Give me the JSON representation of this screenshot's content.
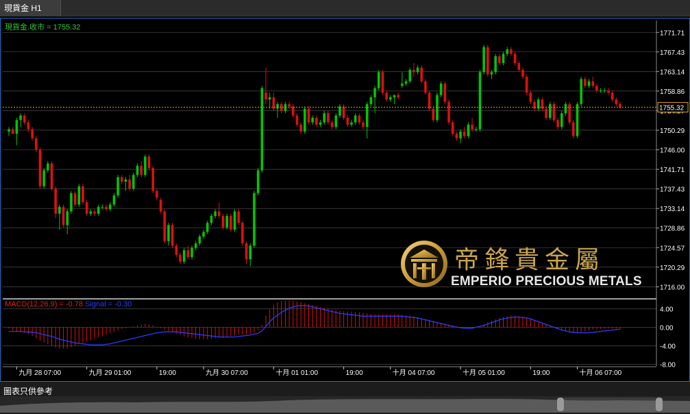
{
  "tab": {
    "label": "現貨金 H1"
  },
  "price_legend": {
    "text": "現貨金.收市 = 1755.32"
  },
  "macd_legend": {
    "macd_text": "MACD(12,26,9) = -0.78",
    "signal_text": "Signal = -0.30"
  },
  "logo": {
    "cn": "帝鋒貴金屬",
    "en": "EMPERIO PRECIOUS METALS"
  },
  "footer": {
    "text": "圖表只供參考"
  },
  "colors": {
    "up": "#00c800",
    "down": "#e01010",
    "grid": "#5a5a5a",
    "macd_hist": "#e01010",
    "signal": "#2a3cff",
    "price_line": "#e8a000",
    "axis_text": "#ffffff"
  },
  "chart_data": {
    "type": "candlestick",
    "price_axis": {
      "ylim": [
        1713.5,
        1774.3
      ],
      "ticks": [
        1771.71,
        1767.43,
        1763.14,
        1758.86,
        1754.57,
        1750.29,
        1746.0,
        1741.71,
        1737.43,
        1733.14,
        1728.86,
        1724.57,
        1720.29,
        1716.0
      ],
      "current_price": 1755.32,
      "current_label": "1755.32"
    },
    "macd_axis": {
      "ylim": [
        -8.4,
        6.0
      ],
      "ticks": [
        "4.00",
        "0.00",
        "-4.00",
        "-8.00"
      ],
      "ticks_values": [
        4,
        0,
        -4,
        -8
      ]
    },
    "x_labels": [
      {
        "label": "九月 28 07:00",
        "bar": 2
      },
      {
        "label": "九月 29 01:00",
        "bar": 20
      },
      {
        "label": "19:00",
        "bar": 38
      },
      {
        "label": "九月 30 07:00",
        "bar": 50
      },
      {
        "label": "十月 01 01:00",
        "bar": 68
      },
      {
        "label": "19:00",
        "bar": 86
      },
      {
        "label": "十月 04 07:00",
        "bar": 98
      },
      {
        "label": "十月 05 01:00",
        "bar": 116
      },
      {
        "label": "19:00",
        "bar": 134
      },
      {
        "label": "十月 06 07:00",
        "bar": 146
      }
    ],
    "candles": [
      [
        1750.0,
        1751.0,
        1749.0,
        1750.5
      ],
      [
        1750.5,
        1751.0,
        1749.5,
        1749.5
      ],
      [
        1749.5,
        1753.0,
        1747.0,
        1752.5
      ],
      [
        1752.5,
        1754.0,
        1751.0,
        1753.5
      ],
      [
        1753.5,
        1754.0,
        1751.5,
        1752.0
      ],
      [
        1752.0,
        1752.5,
        1750.0,
        1750.5
      ],
      [
        1750.5,
        1751.0,
        1748.0,
        1748.5
      ],
      [
        1748.5,
        1749.0,
        1745.5,
        1746.0
      ],
      [
        1746.0,
        1746.5,
        1737.5,
        1738.0
      ],
      [
        1738.0,
        1742.0,
        1737.5,
        1741.5
      ],
      [
        1741.5,
        1743.5,
        1741.0,
        1743.0
      ],
      [
        1743.0,
        1743.5,
        1737.0,
        1737.5
      ],
      [
        1737.5,
        1738.0,
        1731.0,
        1732.0
      ],
      [
        1732.0,
        1734.0,
        1728.5,
        1733.5
      ],
      [
        1733.5,
        1734.0,
        1729.0,
        1729.5
      ],
      [
        1729.5,
        1733.0,
        1727.5,
        1732.5
      ],
      [
        1732.5,
        1737.0,
        1732.0,
        1736.5
      ],
      [
        1736.5,
        1737.0,
        1733.5,
        1734.0
      ],
      [
        1734.0,
        1738.5,
        1733.5,
        1738.0
      ],
      [
        1738.0,
        1738.5,
        1734.0,
        1734.5
      ],
      [
        1734.5,
        1735.0,
        1731.5,
        1732.0
      ],
      [
        1732.0,
        1733.0,
        1731.5,
        1732.5
      ],
      [
        1732.5,
        1733.0,
        1731.5,
        1732.0
      ],
      [
        1732.0,
        1734.0,
        1731.5,
        1733.5
      ],
      [
        1733.5,
        1734.0,
        1733.0,
        1733.5
      ],
      [
        1733.5,
        1734.0,
        1732.5,
        1733.0
      ],
      [
        1733.0,
        1734.5,
        1732.5,
        1734.0
      ],
      [
        1734.0,
        1736.5,
        1733.5,
        1736.0
      ],
      [
        1736.0,
        1740.5,
        1735.5,
        1740.0
      ],
      [
        1740.0,
        1740.5,
        1738.5,
        1739.0
      ],
      [
        1739.0,
        1740.0,
        1737.0,
        1739.5
      ],
      [
        1739.5,
        1740.5,
        1737.0,
        1737.5
      ],
      [
        1737.5,
        1741.0,
        1737.0,
        1740.5
      ],
      [
        1740.5,
        1743.0,
        1740.0,
        1742.5
      ],
      [
        1742.5,
        1743.5,
        1740.0,
        1740.5
      ],
      [
        1740.5,
        1745.0,
        1740.0,
        1744.5
      ],
      [
        1744.5,
        1745.0,
        1741.5,
        1742.0
      ],
      [
        1742.0,
        1742.5,
        1736.5,
        1737.0
      ],
      [
        1737.0,
        1737.5,
        1735.0,
        1735.5
      ],
      [
        1735.0,
        1735.5,
        1732.0,
        1732.5
      ],
      [
        1732.5,
        1733.0,
        1725.5,
        1726.0
      ],
      [
        1726.0,
        1730.0,
        1725.0,
        1729.5
      ],
      [
        1729.5,
        1730.0,
        1724.5,
        1725.0
      ],
      [
        1725.0,
        1725.5,
        1722.5,
        1723.0
      ],
      [
        1723.0,
        1723.5,
        1721.0,
        1721.5
      ],
      [
        1721.5,
        1724.5,
        1721.0,
        1724.0
      ],
      [
        1724.0,
        1725.0,
        1722.0,
        1722.5
      ],
      [
        1722.5,
        1725.0,
        1722.0,
        1724.5
      ],
      [
        1724.5,
        1726.0,
        1724.0,
        1725.5
      ],
      [
        1725.5,
        1727.5,
        1725.0,
        1727.0
      ],
      [
        1727.0,
        1728.5,
        1726.5,
        1728.0
      ],
      [
        1728.0,
        1730.5,
        1727.5,
        1730.0
      ],
      [
        1730.0,
        1732.0,
        1729.5,
        1731.5
      ],
      [
        1731.5,
        1733.0,
        1731.0,
        1732.5
      ],
      [
        1732.5,
        1734.5,
        1731.0,
        1731.5
      ],
      [
        1731.5,
        1732.0,
        1728.5,
        1729.0
      ],
      [
        1729.0,
        1732.0,
        1728.5,
        1731.5
      ],
      [
        1731.5,
        1732.0,
        1728.0,
        1728.5
      ],
      [
        1728.5,
        1733.0,
        1728.0,
        1732.5
      ],
      [
        1732.5,
        1733.0,
        1729.5,
        1730.0
      ],
      [
        1730.0,
        1730.5,
        1725.0,
        1725.5
      ],
      [
        1725.5,
        1726.0,
        1721.0,
        1722.0
      ],
      [
        1722.0,
        1725.5,
        1720.5,
        1725.0
      ],
      [
        1725.0,
        1737.0,
        1724.5,
        1736.5
      ],
      [
        1736.5,
        1742.0,
        1736.0,
        1741.5
      ],
      [
        1741.5,
        1760.0,
        1741.0,
        1759.5
      ],
      [
        1758.5,
        1764.0,
        1756.0,
        1757.0
      ],
      [
        1757.0,
        1758.5,
        1755.0,
        1757.5
      ],
      [
        1757.5,
        1758.5,
        1754.5,
        1755.0
      ],
      [
        1755.0,
        1756.5,
        1753.0,
        1756.0
      ],
      [
        1756.0,
        1756.5,
        1754.0,
        1754.5
      ],
      [
        1754.5,
        1756.5,
        1754.0,
        1756.0
      ],
      [
        1756.0,
        1756.5,
        1755.0,
        1755.5
      ],
      [
        1755.5,
        1756.0,
        1753.0,
        1753.5
      ],
      [
        1753.5,
        1754.0,
        1751.0,
        1751.5
      ],
      [
        1751.5,
        1752.0,
        1749.5,
        1750.0
      ],
      [
        1750.0,
        1755.5,
        1749.5,
        1755.0
      ],
      [
        1755.0,
        1755.5,
        1751.5,
        1752.0
      ],
      [
        1752.0,
        1753.5,
        1751.5,
        1753.0
      ],
      [
        1753.0,
        1753.5,
        1751.0,
        1751.5
      ],
      [
        1751.5,
        1752.5,
        1751.0,
        1752.0
      ],
      [
        1752.0,
        1754.5,
        1751.5,
        1754.0
      ],
      [
        1754.0,
        1754.5,
        1751.5,
        1752.0
      ],
      [
        1752.0,
        1752.5,
        1750.5,
        1751.0
      ],
      [
        1751.0,
        1754.0,
        1750.5,
        1753.5
      ],
      [
        1753.5,
        1756.0,
        1753.0,
        1755.5
      ],
      [
        1755.5,
        1756.0,
        1752.5,
        1753.0
      ],
      [
        1753.0,
        1753.5,
        1751.0,
        1751.5
      ],
      [
        1751.5,
        1752.5,
        1751.0,
        1752.0
      ],
      [
        1752.0,
        1754.0,
        1751.5,
        1753.5
      ],
      [
        1753.5,
        1754.0,
        1751.5,
        1752.0
      ],
      [
        1752.0,
        1752.5,
        1750.5,
        1751.0
      ],
      [
        1751.0,
        1756.5,
        1748.5,
        1756.0
      ],
      [
        1756.0,
        1758.0,
        1755.5,
        1757.5
      ],
      [
        1757.5,
        1760.0,
        1754.0,
        1759.5
      ],
      [
        1759.5,
        1763.5,
        1759.0,
        1763.0
      ],
      [
        1763.0,
        1763.5,
        1758.0,
        1758.5
      ],
      [
        1758.5,
        1759.0,
        1756.5,
        1757.0
      ],
      [
        1757.0,
        1758.0,
        1756.5,
        1757.5
      ],
      [
        1757.5,
        1758.0,
        1756.0,
        1758.0
      ],
      [
        1758.0,
        1758.5,
        1757.0,
        1757.5
      ],
      [
        1760.0,
        1763.0,
        1759.5,
        1760.5
      ],
      [
        1760.5,
        1761.5,
        1760.0,
        1761.0
      ],
      [
        1761.0,
        1764.0,
        1760.5,
        1763.5
      ],
      [
        1763.5,
        1765.0,
        1762.0,
        1763.0
      ],
      [
        1763.0,
        1764.5,
        1762.5,
        1764.0
      ],
      [
        1764.0,
        1764.5,
        1760.5,
        1761.0
      ],
      [
        1761.0,
        1761.5,
        1758.0,
        1758.5
      ],
      [
        1758.5,
        1759.0,
        1754.5,
        1755.0
      ],
      [
        1755.0,
        1755.5,
        1752.0,
        1752.5
      ],
      [
        1752.5,
        1758.5,
        1752.0,
        1758.0
      ],
      [
        1758.0,
        1761.0,
        1757.5,
        1760.5
      ],
      [
        1760.5,
        1761.0,
        1756.0,
        1756.5
      ],
      [
        1756.5,
        1757.0,
        1751.5,
        1752.0
      ],
      [
        1752.0,
        1752.5,
        1749.0,
        1749.5
      ],
      [
        1749.5,
        1750.0,
        1748.0,
        1748.5
      ],
      [
        1748.5,
        1750.5,
        1747.5,
        1750.0
      ],
      [
        1750.0,
        1751.0,
        1748.5,
        1749.0
      ],
      [
        1749.0,
        1752.0,
        1748.5,
        1751.5
      ],
      [
        1751.5,
        1753.0,
        1750.0,
        1750.5
      ],
      [
        1750.5,
        1751.0,
        1750.0,
        1750.5
      ],
      [
        1750.5,
        1763.5,
        1750.0,
        1763.0
      ],
      [
        1763.0,
        1769.0,
        1762.5,
        1768.5
      ],
      [
        1768.5,
        1769.0,
        1762.0,
        1762.5
      ],
      [
        1762.5,
        1763.5,
        1761.5,
        1763.0
      ],
      [
        1763.0,
        1767.0,
        1762.5,
        1766.5
      ],
      [
        1766.5,
        1767.0,
        1764.5,
        1765.0
      ],
      [
        1765.0,
        1767.5,
        1764.5,
        1767.0
      ],
      [
        1767.0,
        1768.5,
        1766.5,
        1768.0
      ],
      [
        1768.0,
        1768.5,
        1766.5,
        1767.0
      ],
      [
        1767.0,
        1767.5,
        1764.5,
        1765.0
      ],
      [
        1765.0,
        1765.5,
        1763.0,
        1763.5
      ],
      [
        1763.5,
        1764.0,
        1761.5,
        1762.0
      ],
      [
        1762.0,
        1762.5,
        1758.0,
        1758.5
      ],
      [
        1758.5,
        1759.0,
        1756.0,
        1756.5
      ],
      [
        1756.5,
        1757.0,
        1754.5,
        1755.0
      ],
      [
        1755.0,
        1757.5,
        1754.5,
        1757.0
      ],
      [
        1757.0,
        1757.5,
        1754.5,
        1755.0
      ],
      [
        1755.0,
        1755.5,
        1752.5,
        1753.0
      ],
      [
        1753.0,
        1756.5,
        1752.5,
        1756.0
      ],
      [
        1756.0,
        1756.5,
        1752.0,
        1752.5
      ],
      [
        1752.5,
        1753.0,
        1750.5,
        1751.0
      ],
      [
        1751.0,
        1754.5,
        1750.5,
        1754.0
      ],
      [
        1754.0,
        1756.5,
        1753.5,
        1756.0
      ],
      [
        1756.0,
        1756.5,
        1751.5,
        1752.0
      ],
      [
        1752.0,
        1752.5,
        1748.5,
        1749.0
      ],
      [
        1749.0,
        1756.5,
        1748.5,
        1756.0
      ],
      [
        1756.0,
        1762.0,
        1755.5,
        1761.5
      ],
      [
        1761.5,
        1762.0,
        1759.5,
        1760.0
      ],
      [
        1760.0,
        1761.5,
        1759.5,
        1761.0
      ],
      [
        1761.0,
        1762.0,
        1759.5,
        1760.0
      ],
      [
        1760.0,
        1760.5,
        1758.5,
        1759.0
      ],
      [
        1759.0,
        1759.5,
        1758.5,
        1759.0
      ],
      [
        1759.0,
        1759.5,
        1758.5,
        1759.0
      ],
      [
        1759.0,
        1759.5,
        1758.0,
        1758.5
      ],
      [
        1758.5,
        1759.0,
        1756.5,
        1757.0
      ],
      [
        1757.0,
        1757.5,
        1755.5,
        1756.0
      ],
      [
        1756.0,
        1756.5,
        1755.0,
        1755.32
      ]
    ],
    "macd_hist": [
      -0.3,
      -0.7,
      -1.0,
      -1.1,
      -1.2,
      -1.5,
      -1.9,
      -2.4,
      -2.9,
      -3.3,
      -3.7,
      -4.1,
      -4.4,
      -4.6,
      -4.6,
      -4.6,
      -4.3,
      -4.0,
      -3.7,
      -3.4,
      -3.1,
      -2.8,
      -2.5,
      -2.2,
      -1.9,
      -1.6,
      -1.3,
      -1.0,
      -0.7,
      -0.4,
      -0.2,
      0.0,
      0.2,
      0.4,
      0.6,
      0.8,
      0.6,
      0.4,
      0.1,
      -0.2,
      -0.5,
      -0.8,
      -1.1,
      -1.4,
      -1.7,
      -2.0,
      -2.2,
      -2.4,
      -2.5,
      -2.6,
      -2.6,
      -2.6,
      -2.5,
      -2.4,
      -2.3,
      -2.3,
      -2.1,
      -1.9,
      -1.8,
      -1.6,
      -1.6,
      -1.6,
      -1.5,
      -1.2,
      -0.6,
      0.5,
      2.5,
      3.8,
      4.8,
      5.4,
      5.7,
      5.8,
      5.8,
      5.7,
      5.6,
      5.4,
      5.2,
      5.0,
      4.8,
      4.6,
      4.4,
      4.2,
      4.0,
      3.8,
      3.7,
      3.6,
      3.5,
      3.4,
      3.4,
      3.3,
      3.2,
      3.1,
      3.0,
      2.9,
      2.8,
      2.8,
      2.8,
      2.8,
      2.8,
      2.8,
      2.8,
      2.7,
      2.6,
      2.5,
      2.4,
      2.2,
      2.0,
      1.8,
      1.6,
      1.4,
      1.2,
      1.0,
      0.8,
      0.6,
      0.4,
      0.2,
      0.0,
      -0.2,
      -0.3,
      -0.2,
      0.0,
      0.3,
      0.7,
      1.1,
      1.4,
      1.7,
      2.0,
      2.2,
      2.4,
      2.5,
      2.5,
      2.4,
      2.3,
      2.1,
      1.8,
      1.5,
      1.2,
      0.9,
      0.6,
      0.3,
      0.0,
      -0.3,
      -0.6,
      -0.8,
      -1.0,
      -1.2,
      -1.2,
      -1.1,
      -0.9,
      -0.7,
      -0.5,
      -0.4,
      -0.3,
      -0.3,
      -0.3,
      -0.3,
      -0.3,
      -0.3
    ],
    "signal": [
      -0.9,
      -0.9,
      -0.9,
      -0.9,
      -1.0,
      -1.0,
      -1.1,
      -1.2,
      -1.4,
      -1.6,
      -1.8,
      -2.0,
      -2.3,
      -2.6,
      -2.8,
      -3.0,
      -3.2,
      -3.4,
      -3.5,
      -3.6,
      -3.7,
      -3.8,
      -3.8,
      -3.8,
      -3.8,
      -3.7,
      -3.6,
      -3.4,
      -3.2,
      -3.0,
      -2.8,
      -2.6,
      -2.4,
      -2.2,
      -2.0,
      -1.8,
      -1.6,
      -1.4,
      -1.2,
      -1.1,
      -1.0,
      -1.0,
      -1.0,
      -1.0,
      -1.1,
      -1.2,
      -1.3,
      -1.4,
      -1.5,
      -1.6,
      -1.7,
      -1.8,
      -1.9,
      -2.0,
      -2.1,
      -2.1,
      -2.1,
      -2.1,
      -2.1,
      -2.0,
      -1.9,
      -1.8,
      -1.7,
      -1.5,
      -1.3,
      -0.8,
      0.2,
      1.2,
      2.0,
      2.6,
      3.2,
      3.7,
      4.1,
      4.4,
      4.6,
      4.7,
      4.7,
      4.6,
      4.4,
      4.2,
      4.0,
      3.8,
      3.6,
      3.4,
      3.2,
      3.0,
      2.9,
      2.8,
      2.7,
      2.6,
      2.5,
      2.4,
      2.4,
      2.4,
      2.4,
      2.4,
      2.4,
      2.4,
      2.4,
      2.4,
      2.4,
      2.4,
      2.3,
      2.2,
      2.1,
      2.0,
      1.8,
      1.6,
      1.4,
      1.2,
      1.0,
      0.8,
      0.6,
      0.4,
      0.2,
      0.0,
      -0.1,
      -0.2,
      -0.2,
      -0.2,
      0.0,
      0.2,
      0.4,
      0.7,
      1.0,
      1.3,
      1.6,
      1.8,
      2.0,
      2.1,
      2.2,
      2.2,
      2.1,
      2.0,
      1.8,
      1.5,
      1.2,
      0.9,
      0.6,
      0.3,
      0.0,
      -0.3,
      -0.6,
      -0.8,
      -1.0,
      -1.1,
      -1.2,
      -1.2,
      -1.2,
      -1.2,
      -1.1,
      -1.0,
      -0.9,
      -0.8,
      -0.7,
      -0.6,
      -0.5,
      -0.4
    ]
  }
}
